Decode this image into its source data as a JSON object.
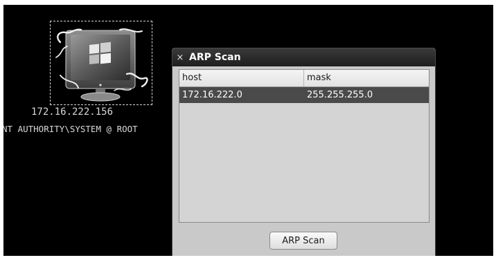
{
  "host": {
    "ip": "172.16.222.156",
    "user": "NT AUTHORITY\\SYSTEM @ ROOT",
    "icon": "windows-monitor-icon"
  },
  "dialog": {
    "close_glyph": "×",
    "title": "ARP Scan",
    "columns": [
      "host",
      "mask"
    ],
    "rows": [
      {
        "host": "172.16.222.0",
        "mask": "255.255.255.0"
      }
    ],
    "button_label": "ARP Scan"
  },
  "colors": {
    "canvas": "#000000",
    "dialog_bg": "#c9c9c9",
    "selected_row": "#4a4a4a"
  }
}
